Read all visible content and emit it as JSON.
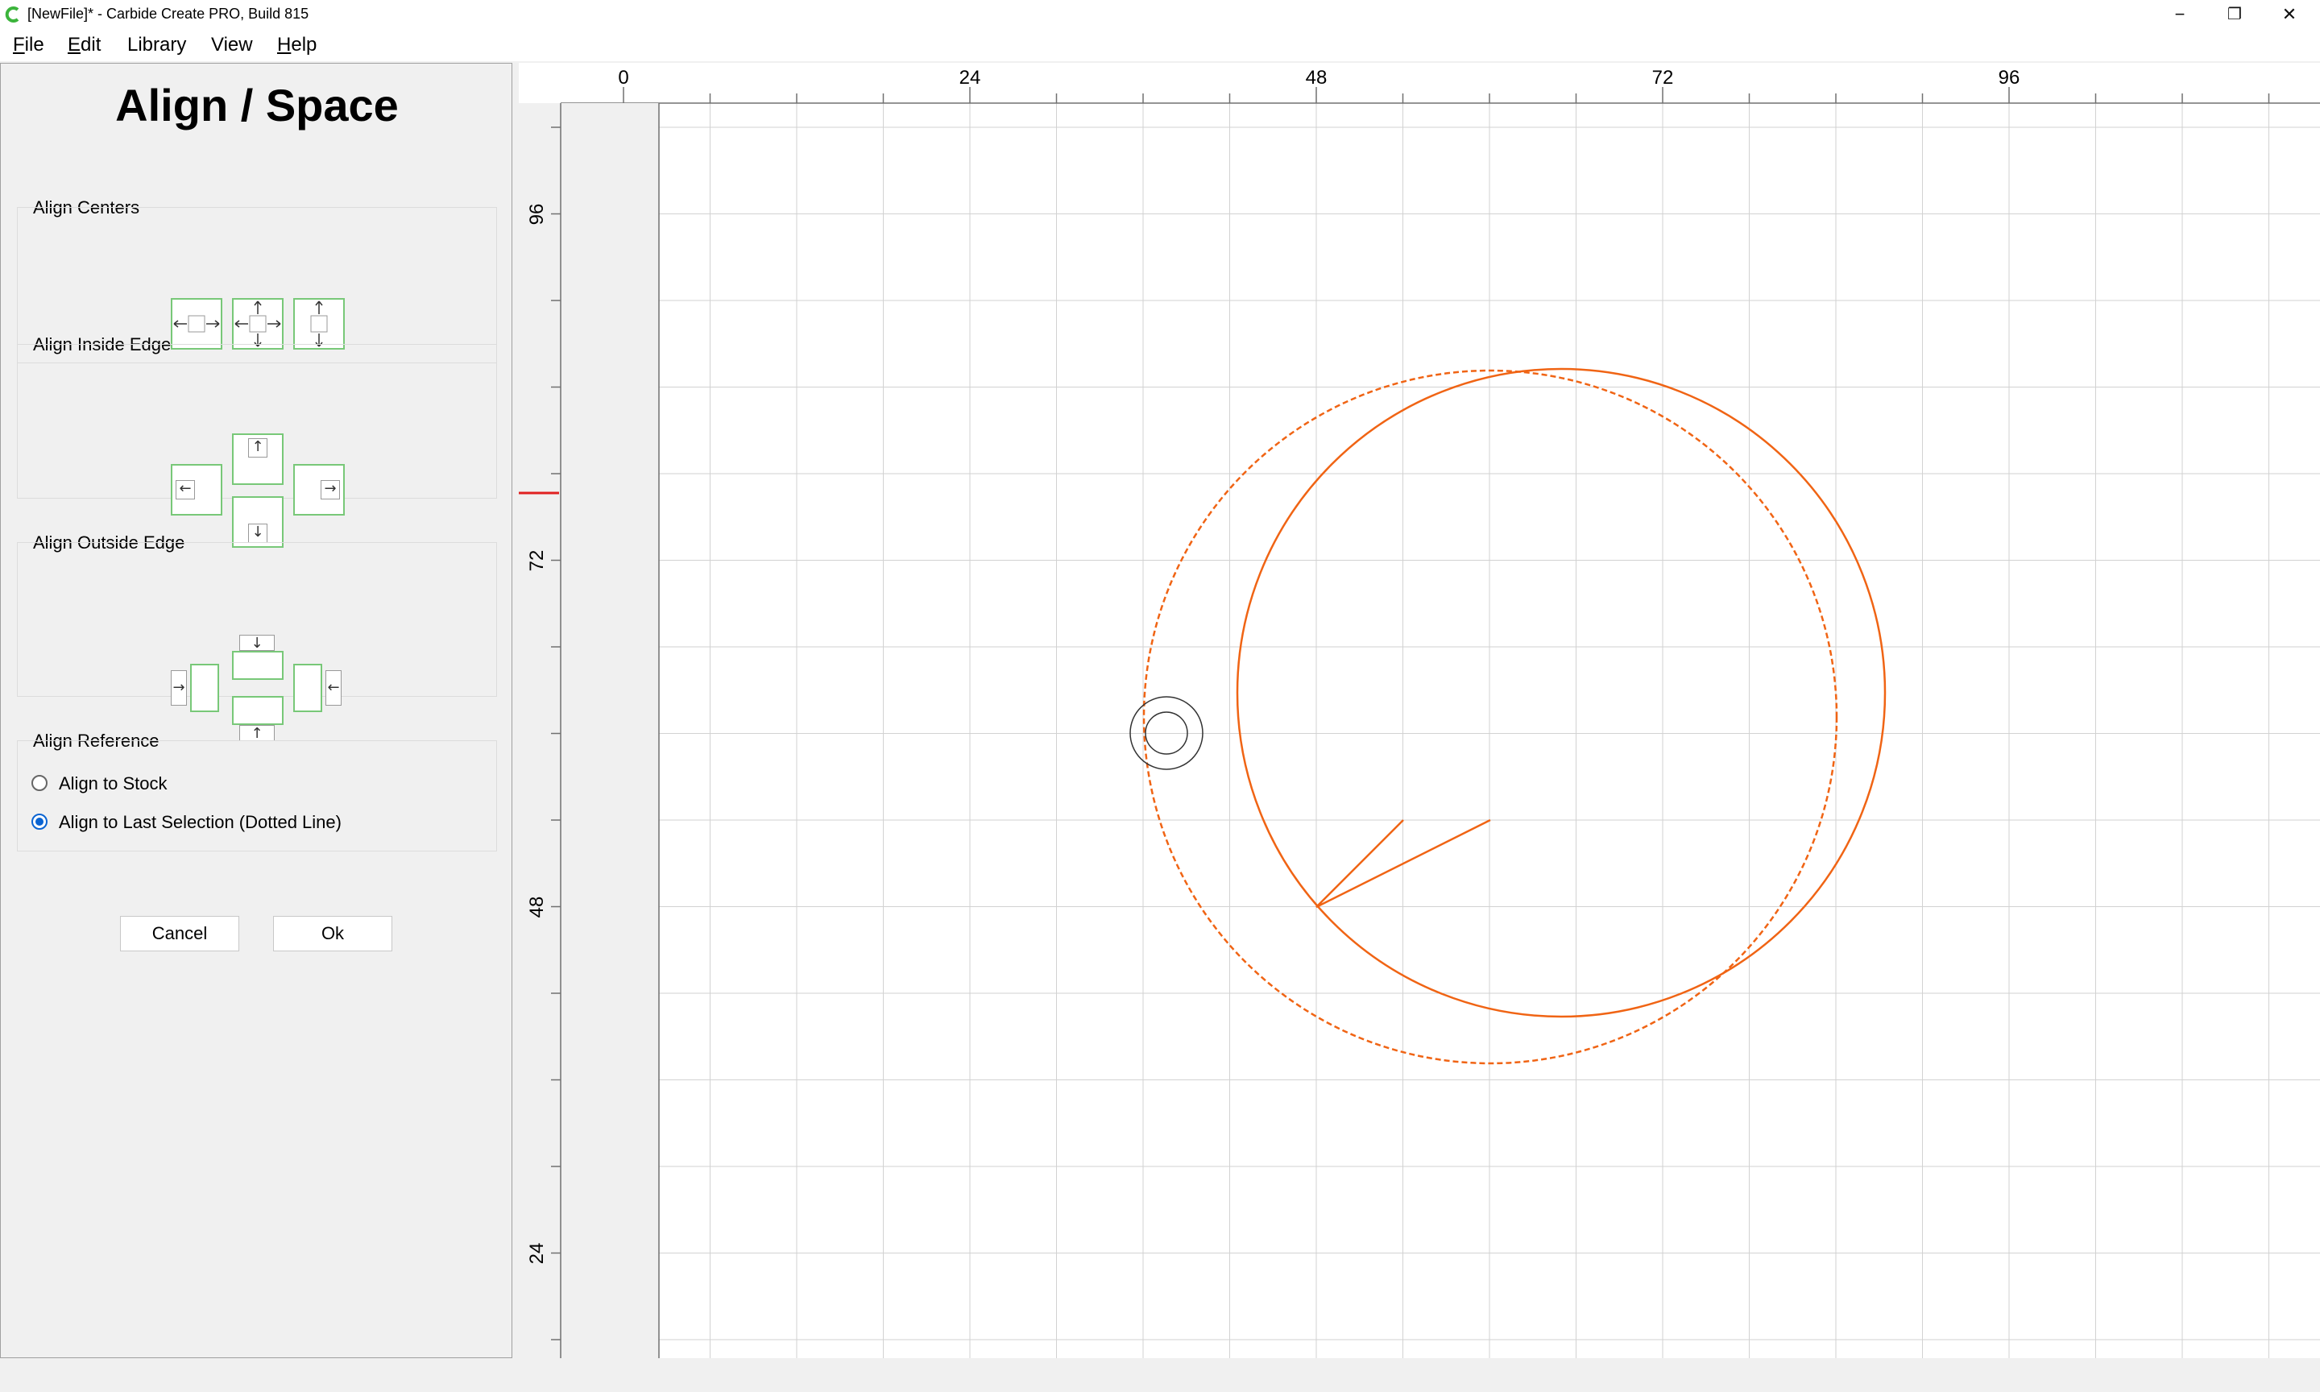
{
  "window": {
    "title": "[NewFile]* - Carbide Create PRO, Build 815",
    "controls": {
      "minimize": "−",
      "restore": "❐",
      "close": "✕"
    }
  },
  "menu": [
    {
      "label_ul": "F",
      "label_rest": "ile"
    },
    {
      "label_ul": "E",
      "label_rest": "dit"
    },
    {
      "label_ul": "",
      "label_rest": "Library"
    },
    {
      "label_ul": "",
      "label_rest": "View"
    },
    {
      "label_ul": "H",
      "label_rest": "elp"
    }
  ],
  "panel": {
    "title": "Align / Space",
    "align_centers_label": "Align Centers",
    "align_inside_edge_label": "Align Inside Edge",
    "align_outside_edge_label": "Align Outside Edge",
    "align_reference_label": "Align Reference",
    "reference_options": [
      {
        "label": "Align to Stock",
        "checked": false
      },
      {
        "label": "Align to Last Selection (Dotted Line)",
        "checked": true
      }
    ],
    "cancel_label": "Cancel",
    "ok_label": "Ok"
  },
  "canvas": {
    "h_ruler_labels": [
      "0",
      "24",
      "48",
      "72",
      "96"
    ],
    "v_ruler_labels": [
      "96",
      "72",
      "48",
      "24"
    ],
    "shape_color": "#f06414",
    "accent_green": "#78c878",
    "radio_blue": "#0a64d2"
  }
}
